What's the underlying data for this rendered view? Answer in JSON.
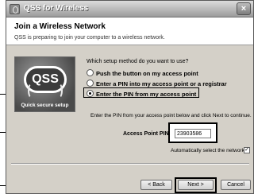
{
  "window": {
    "title": "QSS for Wireless",
    "close_glyph": "×"
  },
  "header": {
    "title": "Join a Wireless Network",
    "subtitle": "QSS is preparing to join your computer to a wireless network."
  },
  "logo": {
    "badge": "QSS",
    "caption": "Quick secure setup"
  },
  "method": {
    "question": "Which setup method do you want to use?",
    "options": [
      {
        "label": "Push the button on my access point",
        "selected": false
      },
      {
        "label": "Enter a PIN into my access point or a registrar",
        "selected": false
      },
      {
        "label": "Enter the PIN from my access point",
        "selected": true
      }
    ]
  },
  "pin": {
    "instruction": "Enter the PIN from your access point below and click Next to continue.",
    "label": "Access Point PIN:",
    "value": "23903586"
  },
  "auto": {
    "label": "Automatically select the network",
    "checked": true,
    "check_glyph": "✓"
  },
  "buttons": {
    "back": "< Back",
    "next": "Next >",
    "cancel": "Cancel"
  },
  "colors": {
    "title_bar": "#9b9b9b",
    "dialog_bg": "#d4d0c8",
    "header_bg": "#ffffff"
  }
}
